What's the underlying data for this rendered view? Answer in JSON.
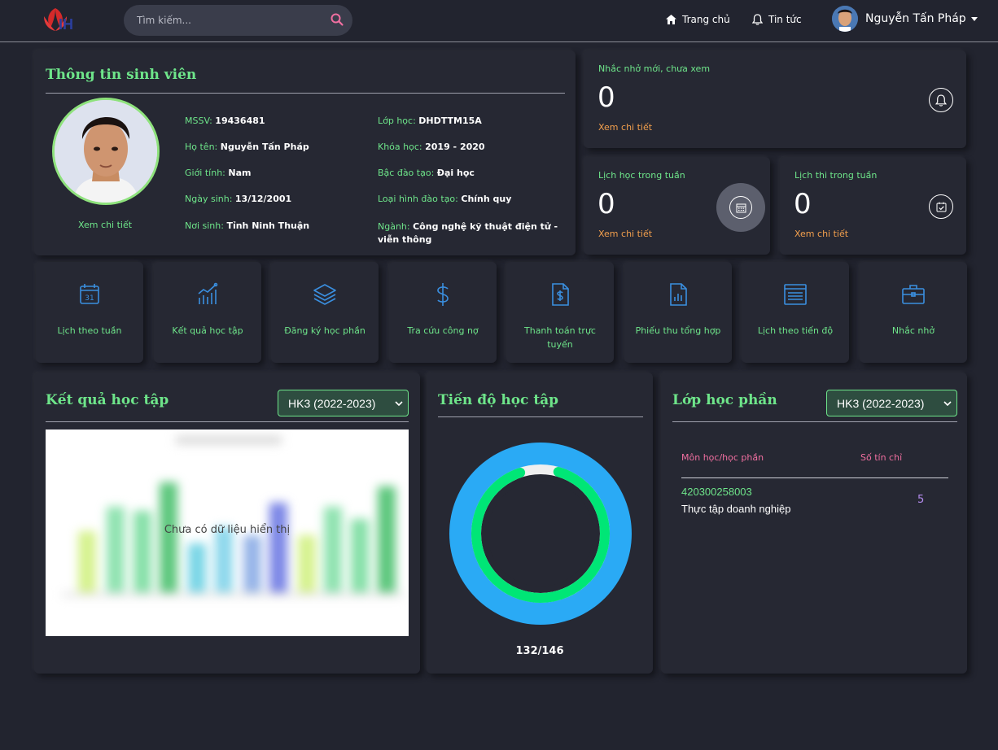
{
  "header": {
    "search_placeholder": "Tìm kiếm...",
    "nav": [
      {
        "label": "Trang chủ",
        "icon": "home-icon"
      },
      {
        "label": "Tin tức",
        "icon": "bell-icon"
      }
    ],
    "user_name": "Nguyễn Tấn Pháp"
  },
  "student": {
    "title": "Thông tin sinh viên",
    "detail_link": "Xem chi tiết",
    "left": [
      {
        "label": "MSSV:",
        "value": "19436481"
      },
      {
        "label": "Họ tên:",
        "value": "Nguyễn Tấn Pháp"
      },
      {
        "label": "Giới tính:",
        "value": "Nam"
      },
      {
        "label": "Ngày sinh:",
        "value": "13/12/2001"
      },
      {
        "label": "Nơi sinh:",
        "value": "Tỉnh Ninh Thuận"
      }
    ],
    "right": [
      {
        "label": "Lớp học:",
        "value": "DHDTTM15A"
      },
      {
        "label": "Khóa học:",
        "value": "2019 - 2020"
      },
      {
        "label": "Bậc đào tạo:",
        "value": "Đại học"
      },
      {
        "label": "Loại hình đào tạo:",
        "value": "Chính quy"
      },
      {
        "label": "Ngành:",
        "value": "Công nghệ kỹ thuật điện tử - viễn thông"
      }
    ]
  },
  "stats": {
    "reminders": {
      "label": "Nhắc nhở mới, chưa xem",
      "value": "0",
      "link": "Xem chi tiết",
      "icon": "bell-icon"
    },
    "week_schedule": {
      "label": "Lịch học trong tuần",
      "value": "0",
      "link": "Xem chi tiết",
      "icon": "calendar-icon"
    },
    "exam_schedule": {
      "label": "Lịch thi trong tuần",
      "value": "0",
      "link": "Xem chi tiết",
      "icon": "calendar-check-icon"
    }
  },
  "quick_links": [
    {
      "label": "Lịch theo tuần",
      "icon": "calendar-31-icon"
    },
    {
      "label": "Kết quả học tập",
      "icon": "bar-chart-icon"
    },
    {
      "label": "Đăng ký học phần",
      "icon": "layers-icon"
    },
    {
      "label": "Tra cứu công nợ",
      "icon": "dollar-icon"
    },
    {
      "label": "Thanh toán trực tuyến",
      "icon": "invoice-icon"
    },
    {
      "label": "Phiếu thu tổng hợp",
      "icon": "report-icon"
    },
    {
      "label": "Lịch theo tiến độ",
      "icon": "list-icon"
    },
    {
      "label": "Nhắc nhở",
      "icon": "briefcase-icon"
    }
  ],
  "results": {
    "title": "Kết quả học tập",
    "semester": "HK3 (2022-2023)",
    "empty_text": "Chưa có dữ liệu hiển thị"
  },
  "progress": {
    "title": "Tiến độ học tập",
    "value_text": "132/146",
    "completed": 132,
    "total": 146,
    "colors": {
      "outer": "#2aaaf5",
      "progress": "#00e676",
      "track": "#efefef"
    }
  },
  "classes": {
    "title": "Lớp học phần",
    "semester": "HK3 (2022-2023)",
    "col_subject": "Môn học/học phần",
    "col_credits": "Số tín chỉ",
    "rows": [
      {
        "code": "420300258003",
        "name": "Thực tập doanh nghiệp",
        "credits": "5"
      }
    ]
  }
}
